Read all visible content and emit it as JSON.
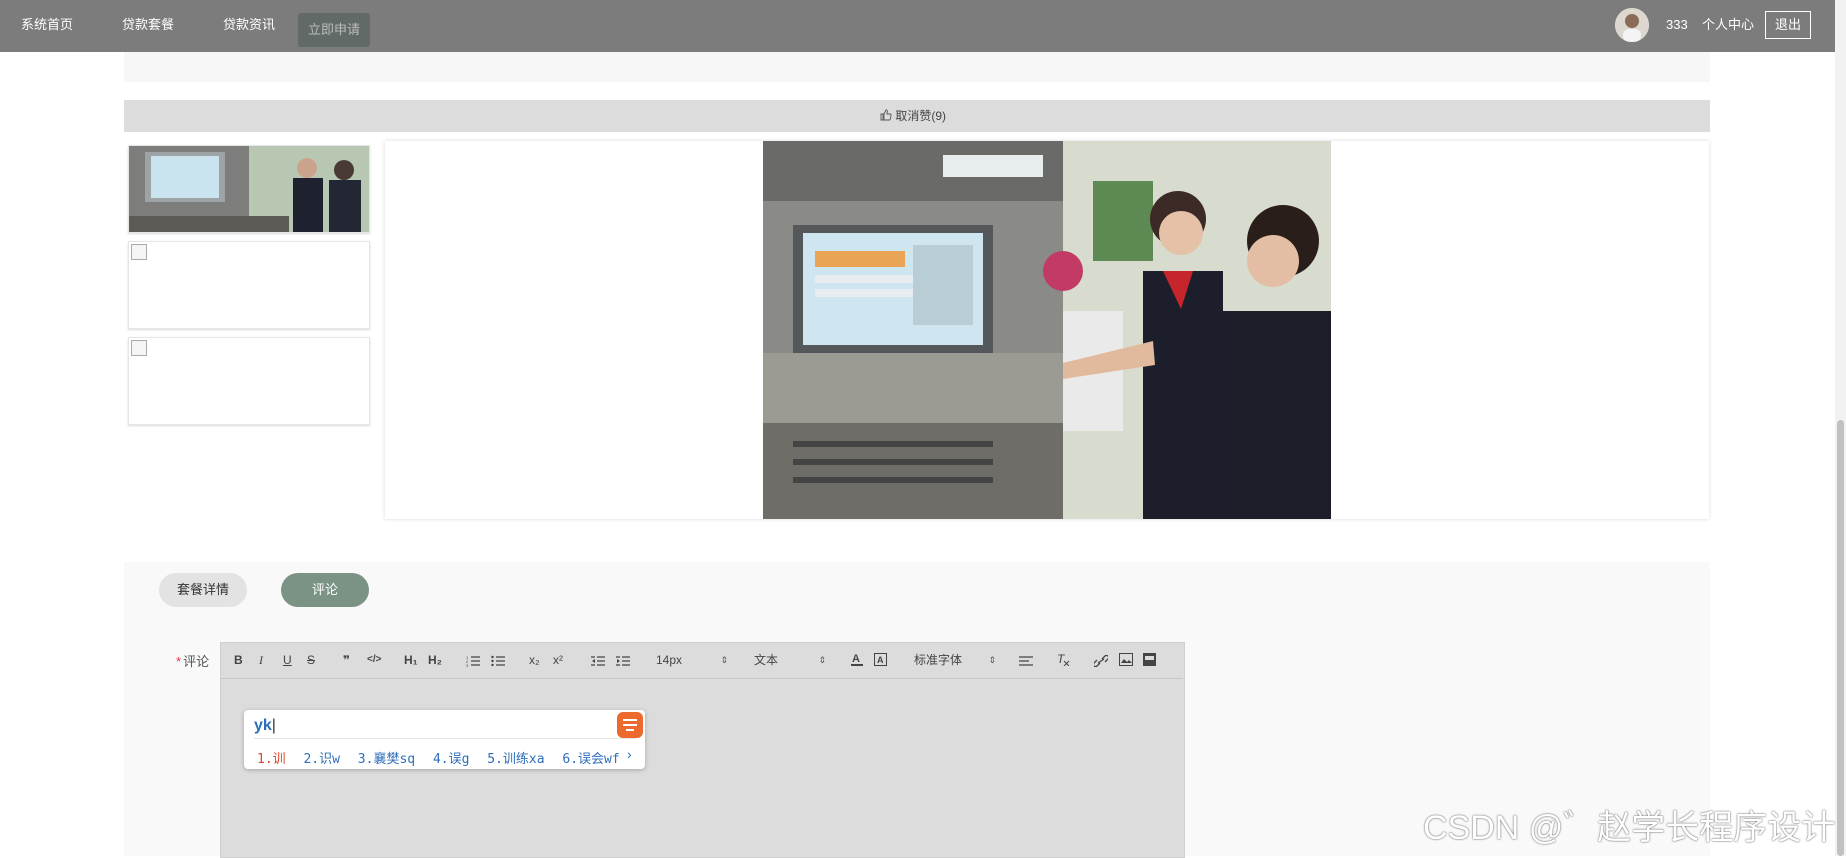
{
  "nav": {
    "items": [
      "系统首页",
      "贷款套餐",
      "贷款资讯"
    ],
    "apply_label": "立即申请",
    "username": "333",
    "profile_label": "个人中心",
    "logout_label": "退出"
  },
  "like_bar": {
    "label": "取消赞(9)"
  },
  "tabs": {
    "detail": "套餐详情",
    "comment": "评论"
  },
  "comment": {
    "required_mark": "*",
    "label": "评论"
  },
  "toolbar": {
    "bold": "B",
    "italic": "I",
    "underline": "U",
    "strike": "S",
    "quote": "❞",
    "code": "</>",
    "h1": "H₁",
    "h2": "H₂",
    "sub": "x₂",
    "sup": "x²",
    "font_size": "14px",
    "block_format": "文本",
    "font_family": "标准字体"
  },
  "ime": {
    "input": "yk",
    "candidates": [
      "1.训",
      "2.识w",
      "3.襄樊sq",
      "4.误g",
      "5.训练xa",
      "6.误会wf"
    ]
  },
  "watermark": "CSDN @゛赵学长程序设计",
  "colors": {
    "nav_bg": "#7c7c7c",
    "tab_active": "#7a9385",
    "ime_candidate": "#2f6fba"
  }
}
